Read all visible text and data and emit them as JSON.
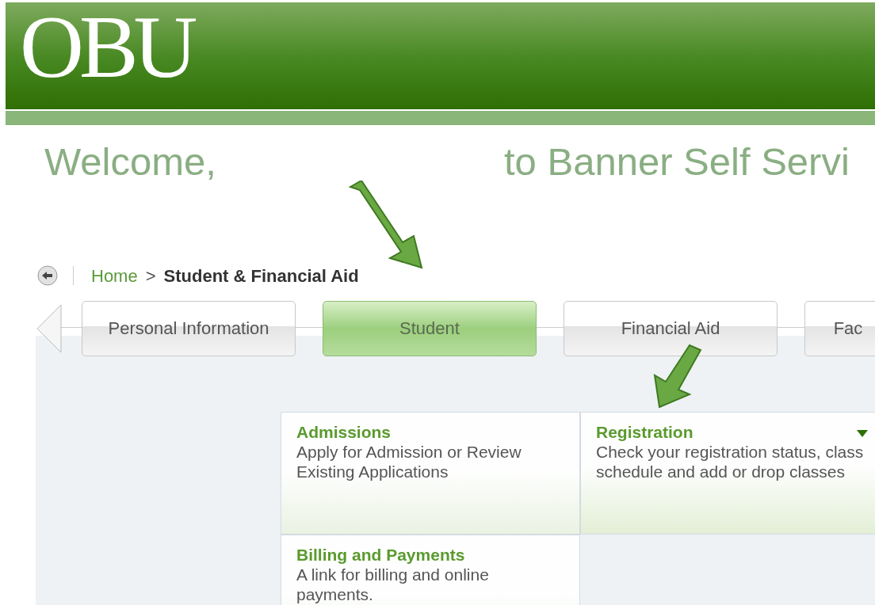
{
  "header": {
    "logo": "OBU"
  },
  "welcome": {
    "greeting": "Welcome,",
    "title": "to Banner Self Servi"
  },
  "breadcrumb": {
    "home": "Home",
    "separator": ">",
    "current": "Student & Financial Aid"
  },
  "tabs": [
    {
      "label": "Personal Information",
      "selected": false
    },
    {
      "label": "Student",
      "selected": true
    },
    {
      "label": "Financial Aid",
      "selected": false
    },
    {
      "label": "Fac",
      "selected": false
    }
  ],
  "cards": [
    {
      "title": "Admissions",
      "description": "Apply for Admission or Review Existing Applications",
      "expanded": false
    },
    {
      "title": "Registration",
      "description": "Check your registration status, class schedule and add or drop classes",
      "expanded": true
    },
    {
      "title": "Billing and Payments",
      "description": "A link for billing and online payments.",
      "expanded": false
    }
  ]
}
